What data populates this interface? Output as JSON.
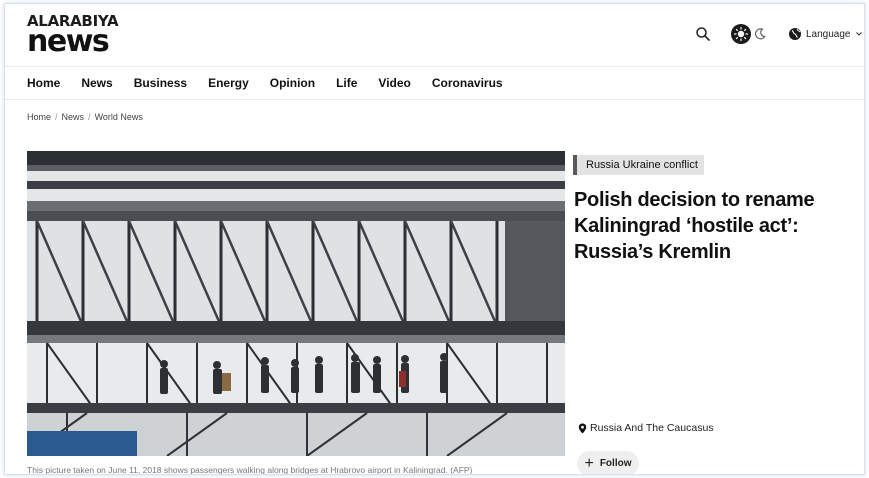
{
  "brand": {
    "logo_top": "ALARABIYA",
    "logo_main": "news"
  },
  "header": {
    "language_label": "Language"
  },
  "nav": {
    "items": [
      "Home",
      "News",
      "Business",
      "Energy",
      "Opinion",
      "Life",
      "Video",
      "Coronavirus"
    ]
  },
  "breadcrumb": [
    "Home",
    "News",
    "World News"
  ],
  "article": {
    "tag": "Russia Ukraine conflict",
    "headline": "Polish decision to rename Kaliningrad ‘hostile act’: Russia’s Kremlin",
    "image_caption": "This picture taken on June 11, 2018 shows passengers walking along bridges at Hrabrovo airport in Kaliningrad. (AFP)",
    "location": "Russia And The Caucasus",
    "follow_label": "Follow"
  },
  "icons": {
    "search": "search-icon",
    "theme_light": "sun-icon",
    "theme_dark": "moon-icon",
    "language": "globe-icon",
    "chevron": "chevron-down-icon",
    "location": "location-pin-icon",
    "follow": "plus-icon"
  },
  "colors": {
    "tag_bg": "#e3e3e3",
    "tag_border": "#5a5a5a",
    "text": "#111111"
  }
}
